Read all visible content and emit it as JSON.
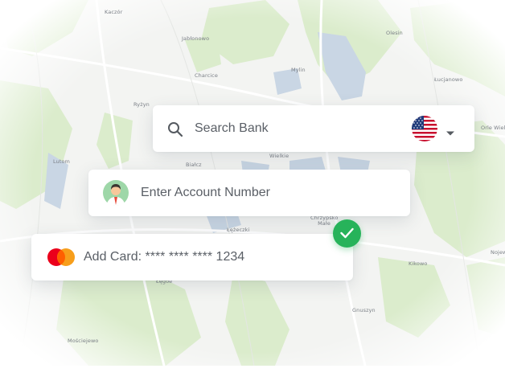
{
  "map": {
    "labels": [
      "Kaczór",
      "Jabłonowo",
      "Olesin",
      "Mylin",
      "Charcice",
      "Łucjanowo",
      "Ryżyn",
      "Wielkie",
      "Białcz",
      "Lutom",
      "Orle Wielkie",
      "Chrzypsko Małe",
      "Łężeczki",
      "Kikowo",
      "Gnuszyn",
      "Mościejewo",
      "Łęgoe",
      "Nojewo"
    ]
  },
  "search": {
    "placeholder": "Search Bank",
    "search_icon": "search-icon",
    "country_flag": "us-flag-icon",
    "dropdown_icon": "caret-down-icon"
  },
  "account": {
    "placeholder": "Enter Account Number",
    "avatar_icon": "user-avatar-icon"
  },
  "card": {
    "label": "Add Card: **** **** **** 1234",
    "brand_icon": "mastercard-icon"
  },
  "status": {
    "icon": "check-icon",
    "color": "#27b35a"
  }
}
